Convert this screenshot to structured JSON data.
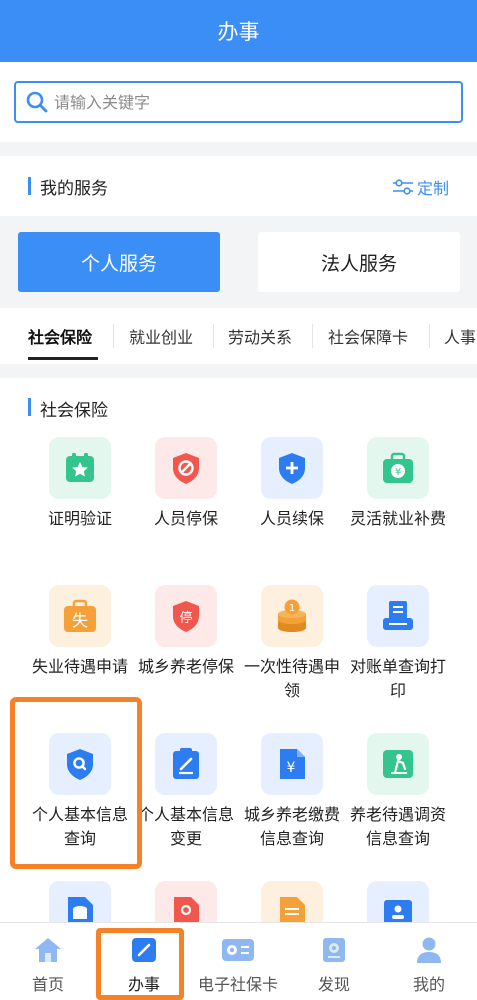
{
  "header": {
    "title": "办事"
  },
  "search": {
    "placeholder": "请输入关键字"
  },
  "my_services": {
    "title": "我的服务",
    "customize_label": "定制"
  },
  "service_tabs": [
    {
      "label": "个人服务",
      "active": true
    },
    {
      "label": "法人服务",
      "active": false
    }
  ],
  "category_tabs": [
    {
      "label": "社会保险",
      "active": true
    },
    {
      "label": "就业创业",
      "active": false
    },
    {
      "label": "劳动关系",
      "active": false
    },
    {
      "label": "社会保障卡",
      "active": false
    },
    {
      "label": "人事",
      "active": false
    }
  ],
  "section": {
    "title": "社会保险"
  },
  "services": [
    {
      "label": "证明验证",
      "icon": "certificate-star-icon",
      "color": "#34c48e",
      "bg": "#e3f7ef"
    },
    {
      "label": "人员停保",
      "icon": "stop-shield-icon",
      "color": "#f0574e",
      "bg": "#fde9e7"
    },
    {
      "label": "人员续保",
      "icon": "plus-shield-icon",
      "color": "#2d7cf0",
      "bg": "#e5efff"
    },
    {
      "label": "灵活就业补费",
      "icon": "yuan-briefcase-icon",
      "color": "#34c48e",
      "bg": "#e3f7ef"
    },
    {
      "label": "失业待遇申请",
      "icon": "unemployment-bag-icon",
      "color": "#f4a13a",
      "bg": "#fdf0de"
    },
    {
      "label": "城乡养老停保",
      "icon": "pension-stop-shield-icon",
      "color": "#f0574e",
      "bg": "#fde9e7"
    },
    {
      "label": "一次性待遇申领",
      "icon": "coin-stack-icon",
      "color": "#f4a13a",
      "bg": "#fdf0de"
    },
    {
      "label": "对账单查询打印",
      "icon": "printer-icon",
      "color": "#2d7cf0",
      "bg": "#e5efff"
    },
    {
      "label": "个人基本信息查询",
      "icon": "search-shield-icon",
      "color": "#2d7cf0",
      "bg": "#e5efff"
    },
    {
      "label": "个人基本信息变更",
      "icon": "edit-clipboard-icon",
      "color": "#2d7cf0",
      "bg": "#e5efff"
    },
    {
      "label": "城乡养老缴费信息查询",
      "icon": "yuan-document-icon",
      "color": "#2d7cf0",
      "bg": "#e5efff"
    },
    {
      "label": "养老待遇调资信息查询",
      "icon": "elder-care-icon",
      "color": "#34c48e",
      "bg": "#e3f7ef"
    },
    {
      "label": "",
      "icon": "database-document-icon",
      "color": "#2d7cf0",
      "bg": "#e5efff"
    },
    {
      "label": "",
      "icon": "person-document-icon",
      "color": "#f0574e",
      "bg": "#fde9e7"
    },
    {
      "label": "",
      "icon": "list-document-icon",
      "color": "#f4a13a",
      "bg": "#fdf0de"
    },
    {
      "label": "",
      "icon": "id-card-icon",
      "color": "#2d7cf0",
      "bg": "#e5efff"
    }
  ],
  "tabbar": [
    {
      "label": "首页",
      "icon": "home-icon"
    },
    {
      "label": "办事",
      "icon": "pencil-icon",
      "active": true
    },
    {
      "label": "电子社保卡",
      "icon": "card-icon"
    },
    {
      "label": "发现",
      "icon": "discover-icon"
    },
    {
      "label": "我的",
      "icon": "user-icon"
    }
  ],
  "colors": {
    "primary": "#3a8ef6",
    "highlight": "#f4822b"
  }
}
